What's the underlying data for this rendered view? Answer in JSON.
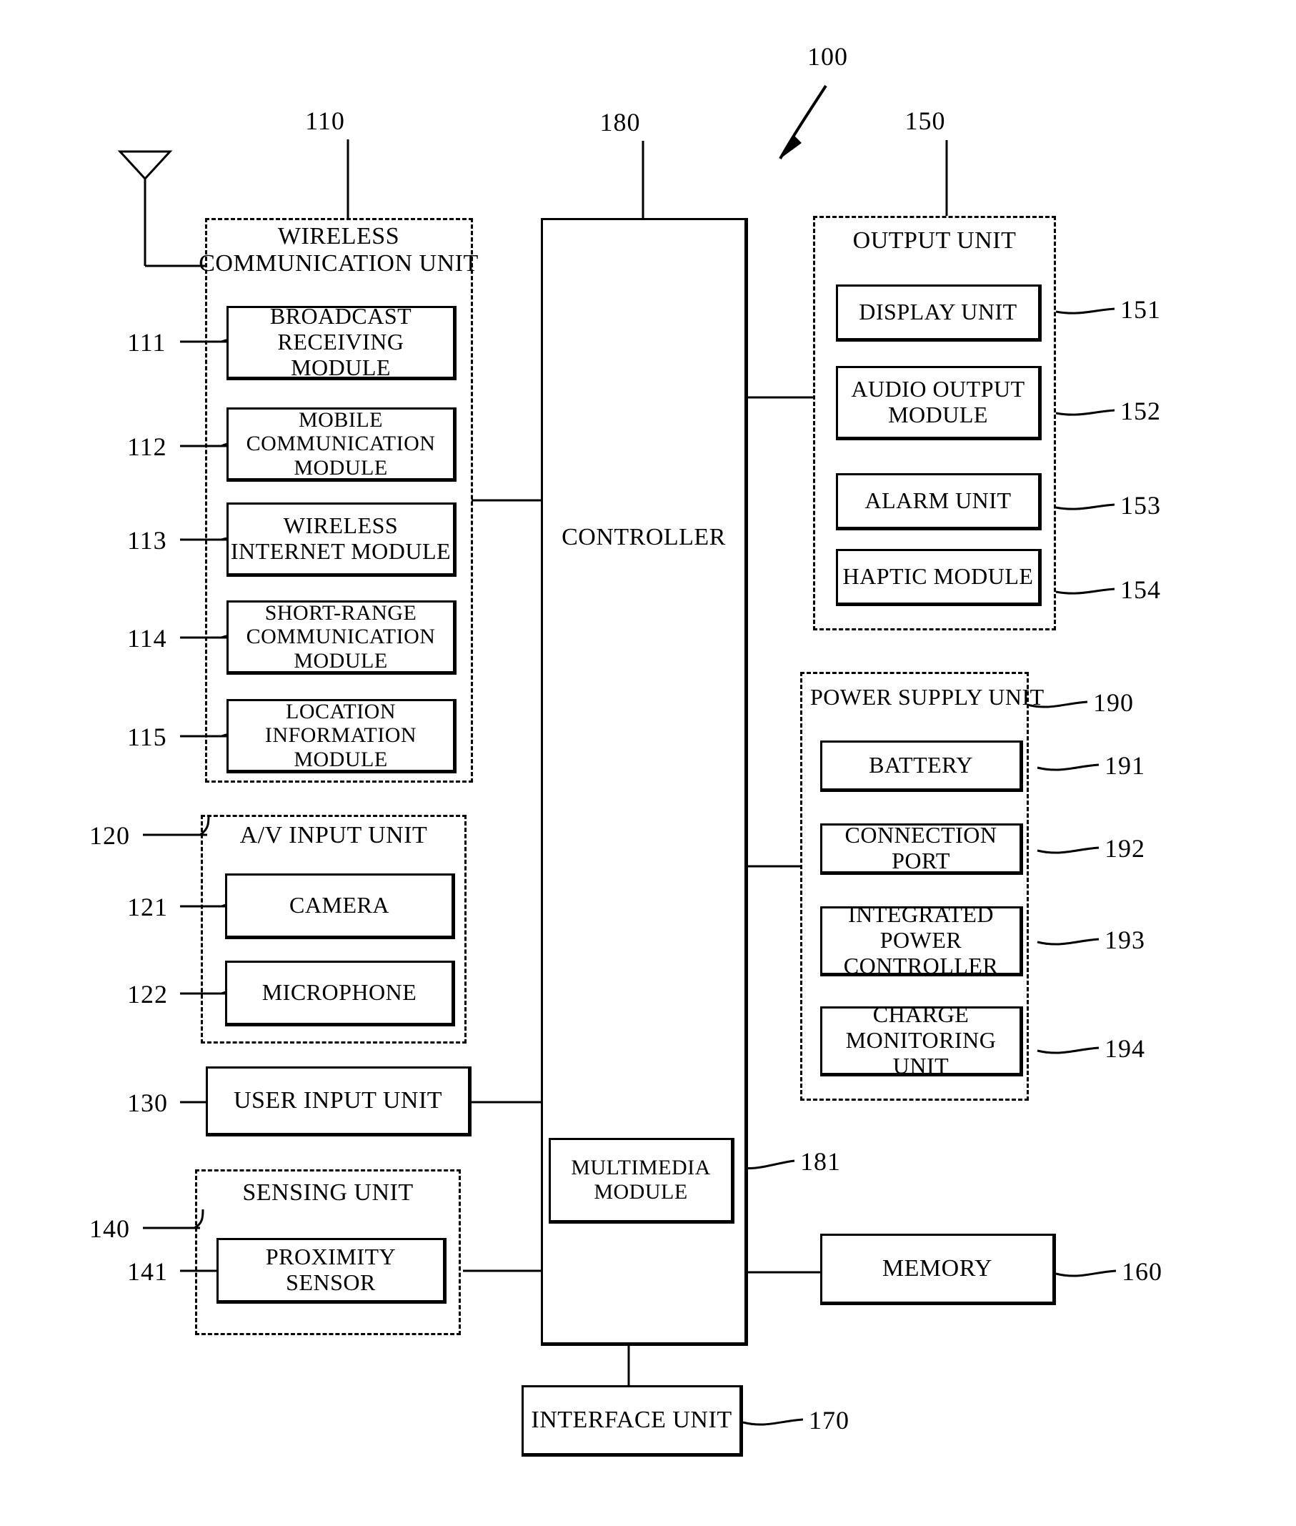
{
  "figure": {
    "title_ref": "100",
    "type": "patent-block-diagram"
  },
  "refs": {
    "device": "100",
    "wireless_communication_unit": "110",
    "broadcast_receiving_module": "111",
    "mobile_communication_module": "112",
    "wireless_internet_module": "113",
    "short_range_communication_module": "114",
    "location_information_module": "115",
    "av_input_unit": "120",
    "camera": "121",
    "microphone": "122",
    "user_input_unit": "130",
    "sensing_unit": "140",
    "proximity_sensor": "141",
    "output_unit": "150",
    "display_unit": "151",
    "audio_output_module": "152",
    "alarm_unit": "153",
    "haptic_module": "154",
    "memory": "160",
    "interface_unit": "170",
    "controller": "180",
    "multimedia_module": "181",
    "power_supply_unit": "190",
    "battery": "191",
    "connection_port": "192",
    "integrated_power_controller": "193",
    "charge_monitoring_unit": "194"
  },
  "blocks": {
    "wireless_communication_unit": {
      "label_line1": "WIRELESS",
      "label_line2": "COMMUNICATION UNIT",
      "modules": [
        {
          "line1": "BROADCAST",
          "line2": "RECEIVING MODULE",
          "ref": "111"
        },
        {
          "line1": "MOBILE",
          "line2": "COMMUNICATION MODULE",
          "ref": "112"
        },
        {
          "line1": "WIRELESS",
          "line2": "INTERNET MODULE",
          "ref": "113"
        },
        {
          "line1": "SHORT-RANGE",
          "line2": "COMMUNICATION MODULE",
          "ref": "114"
        },
        {
          "line1": "LOCATION",
          "line2": "INFORMATION MODULE",
          "ref": "115"
        }
      ]
    },
    "av_input_unit": {
      "label": "A/V INPUT UNIT",
      "modules": [
        {
          "line1": "CAMERA",
          "ref": "121"
        },
        {
          "line1": "MICROPHONE",
          "ref": "122"
        }
      ]
    },
    "user_input_unit": {
      "label": "USER INPUT UNIT",
      "ref": "130"
    },
    "sensing_unit": {
      "label": "SENSING UNIT",
      "modules": [
        {
          "line1": "PROXIMITY SENSOR",
          "ref": "141"
        }
      ]
    },
    "controller": {
      "label": "CONTROLLER",
      "ref": "180"
    },
    "multimedia_module": {
      "line1": "MULTIMEDIA",
      "line2": "MODULE",
      "ref": "181"
    },
    "output_unit": {
      "label": "OUTPUT UNIT",
      "modules": [
        {
          "line1": "DISPLAY UNIT",
          "ref": "151"
        },
        {
          "line1": "AUDIO OUTPUT",
          "line2": "MODULE",
          "ref": "152"
        },
        {
          "line1": "ALARM UNIT",
          "ref": "153"
        },
        {
          "line1": "HAPTIC MODULE",
          "ref": "154"
        }
      ]
    },
    "power_supply_unit": {
      "label": "POWER SUPPLY UNIT",
      "modules": [
        {
          "line1": "BATTERY",
          "ref": "191"
        },
        {
          "line1": "CONNECTION PORT",
          "ref": "192"
        },
        {
          "line1": "INTEGRATED POWER",
          "line2": "CONTROLLER",
          "ref": "193"
        },
        {
          "line1": "CHARGE MONITORING",
          "line2": "UNIT",
          "ref": "194"
        }
      ]
    },
    "memory": {
      "label": "MEMORY",
      "ref": "160"
    },
    "interface_unit": {
      "label": "INTERFACE UNIT",
      "ref": "170"
    }
  },
  "icons": {
    "antenna": "antenna-icon",
    "pointer": "arrow-pointer-icon"
  },
  "colors": {
    "line": "#000000",
    "background": "#ffffff"
  }
}
